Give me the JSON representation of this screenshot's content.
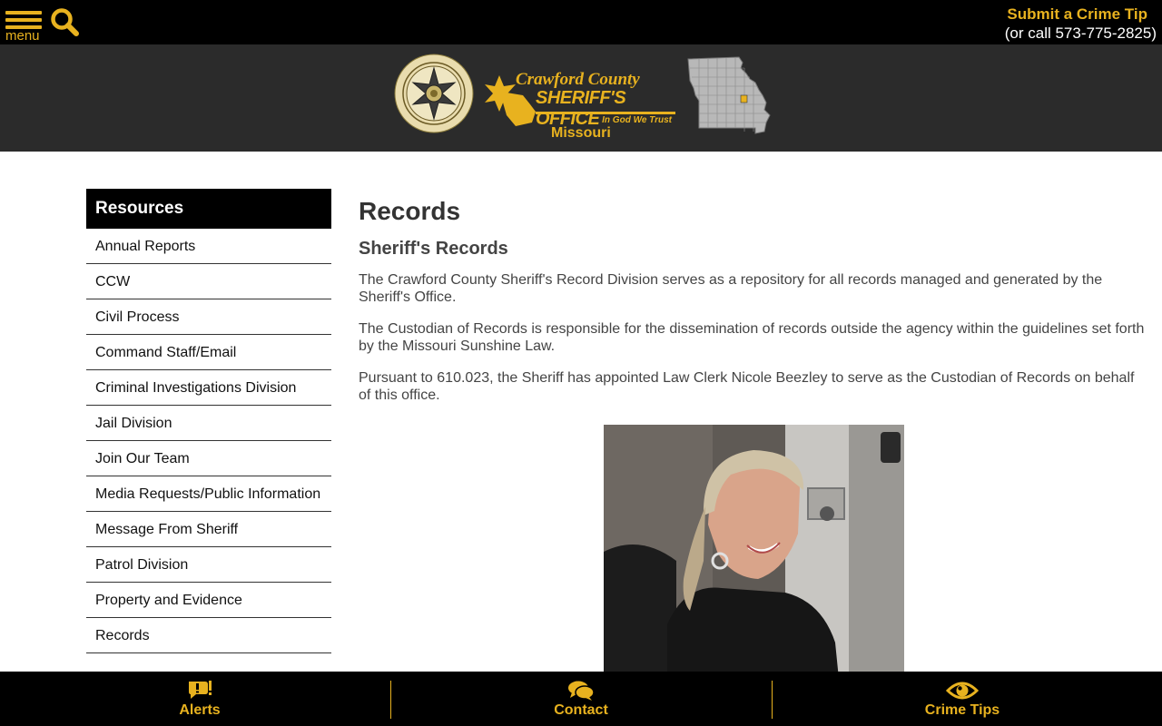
{
  "header": {
    "menu_label": "menu",
    "crime_tip_title": "Submit a Crime Tip",
    "crime_tip_phone": "(or call 573-775-2825)"
  },
  "banner": {
    "seal_icon": "sheriff-star-seal",
    "logo_line1": "Crawford County",
    "logo_line2": "SHERIFF'S OFFICE",
    "logo_motto": "In God We Trust",
    "logo_state": "Missouri",
    "map_icon": "missouri-county-map"
  },
  "sidebar": {
    "heading": "Resources",
    "items": [
      {
        "label": "Annual Reports"
      },
      {
        "label": "CCW"
      },
      {
        "label": "Civil Process"
      },
      {
        "label": "Command Staff/Email"
      },
      {
        "label": "Criminal Investigations Division"
      },
      {
        "label": "Jail Division"
      },
      {
        "label": "Join Our Team"
      },
      {
        "label": "Media Requests/Public Information"
      },
      {
        "label": "Message From Sheriff"
      },
      {
        "label": "Patrol Division"
      },
      {
        "label": "Property and Evidence"
      },
      {
        "label": "Records"
      }
    ]
  },
  "main": {
    "title": "Records",
    "subtitle": "Sheriff's Records",
    "paragraphs": [
      "The Crawford County Sheriff's Record Division serves as a repository for all records managed and generated by the Sheriff's Office.",
      "The Custodian of Records is responsible for the dissemination of records outside the agency within the guidelines set forth by the Missouri Sunshine Law.",
      "Pursuant to 610.023, the Sheriff has appointed Law Clerk Nicole Beezley to serve as the Custodian of Records on behalf of this office."
    ]
  },
  "bottom_nav": {
    "alerts": "Alerts",
    "contact": "Contact",
    "crime_tips": "Crime Tips"
  },
  "colors": {
    "accent": "#e8b21f",
    "topbar": "#000000",
    "banner": "#2b2b2b"
  }
}
